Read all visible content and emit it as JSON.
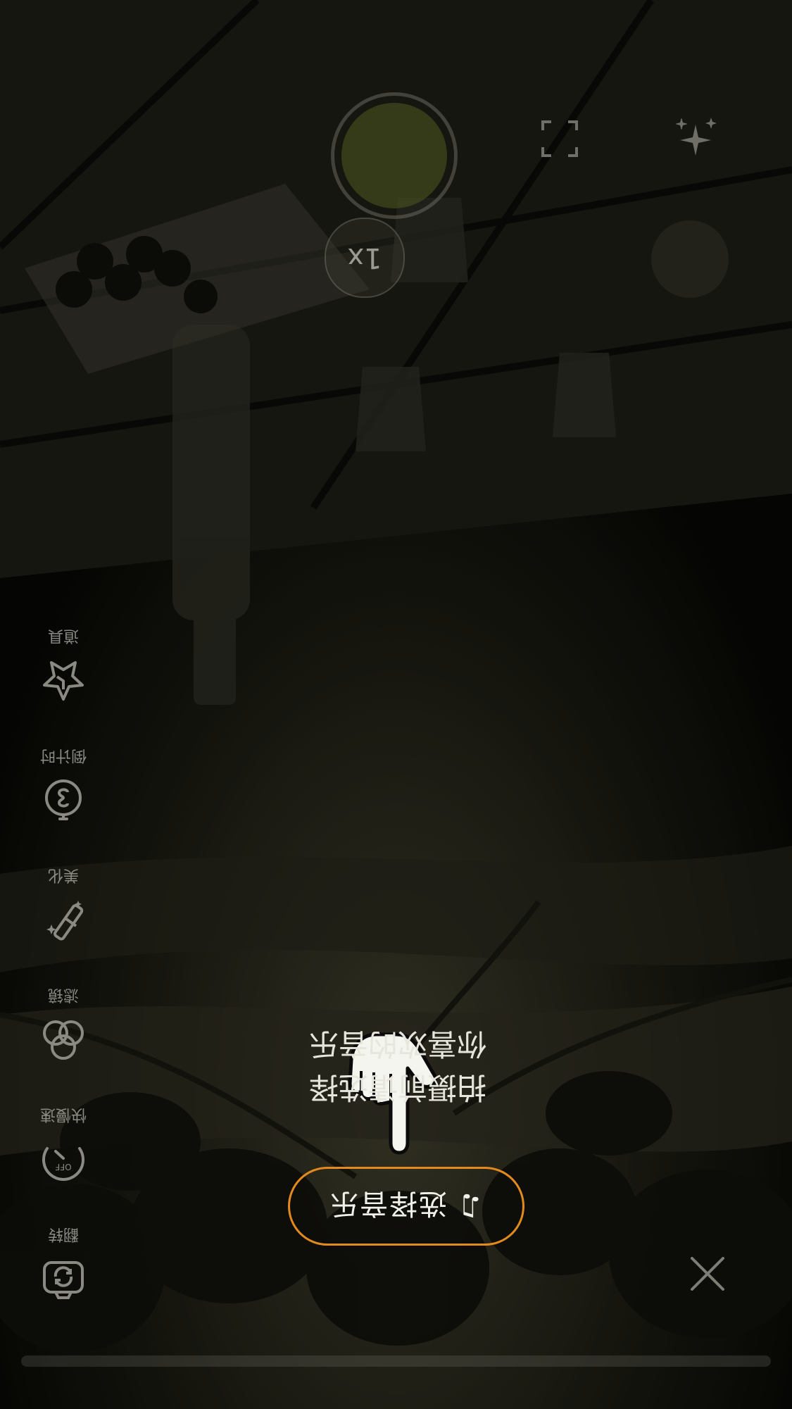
{
  "music": {
    "note_glyph": "♫",
    "label": "选择音乐"
  },
  "tip": {
    "text": "拍摄前请选择\n你喜欢的音乐"
  },
  "tools": [
    {
      "label": "翻转",
      "icon": "camera-flip-icon"
    },
    {
      "label": "快慢速",
      "icon": "speed-off-icon"
    },
    {
      "label": "滤镜",
      "icon": "filter-icon"
    },
    {
      "label": "美化",
      "icon": "beauty-wand-icon"
    },
    {
      "label": "倒计时",
      "icon": "countdown-timer-icon"
    },
    {
      "label": "道具",
      "icon": "props-star-icon"
    }
  ],
  "speed_icon_text": "OFF",
  "zoom": {
    "label": "1x"
  },
  "colors": {
    "accent": "#e28a1e",
    "text": "#f1f1ea",
    "tool": "#8a8a82"
  }
}
